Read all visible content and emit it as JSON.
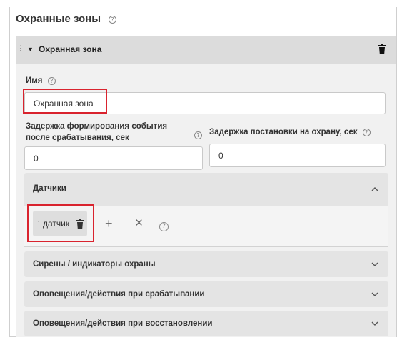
{
  "page": {
    "title": "Охранные зоны"
  },
  "zone": {
    "title": "Охранная зона",
    "name_label": "Имя",
    "name_value": "Охранная зона",
    "delay_event_label_line1": "Задержка формирования события",
    "delay_event_label_line2": "после срабатывания, сек",
    "delay_event_value": "0",
    "delay_arm_label": "Задержка постановки на охрану, сек",
    "delay_arm_value": "0"
  },
  "sensors": {
    "title": "Датчики",
    "items": [
      {
        "label": "датчик"
      }
    ]
  },
  "sections": [
    {
      "title": "Сирены / индикаторы охраны"
    },
    {
      "title": "Оповещения/действия при срабатывании"
    },
    {
      "title": "Оповещения/действия при восстановлении"
    }
  ],
  "icons": {
    "help": "?",
    "add": "+",
    "clear": "×",
    "caret": "▼"
  },
  "colors": {
    "highlight": "#d9232e"
  }
}
